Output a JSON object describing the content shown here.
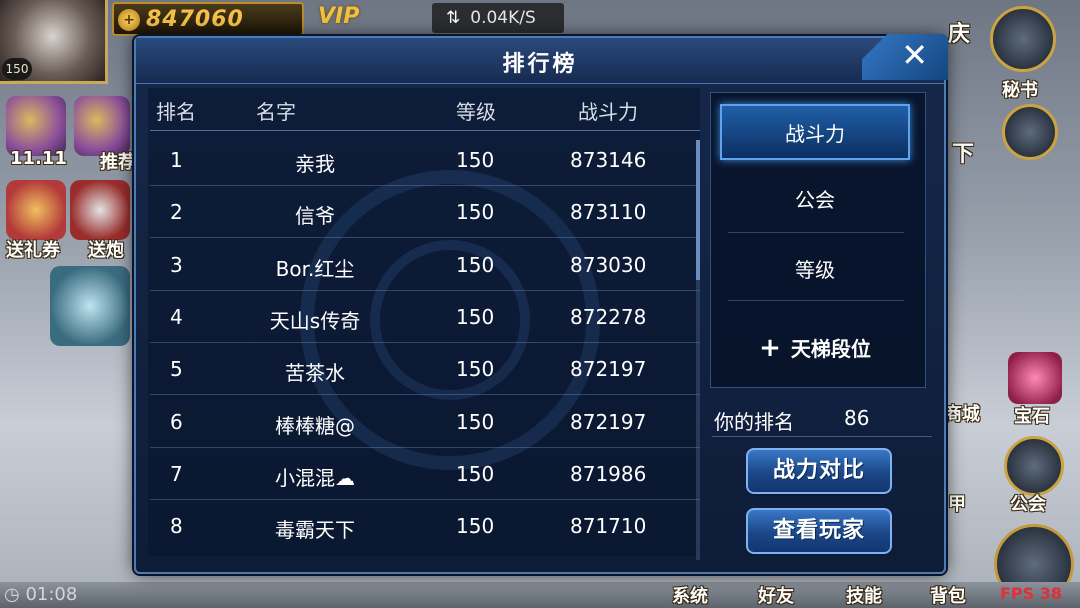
{
  "hud": {
    "player_level": "150",
    "gold": "847060",
    "vip_label": "VIP",
    "net_speed": "0.04K/S",
    "net_icon": "transfer-arrows-icon",
    "left_items": [
      {
        "label": "11.11",
        "icon": "gift-box-icon"
      },
      {
        "label": "推荐",
        "icon": "recommend-icon"
      },
      {
        "label": "送礼券",
        "icon": "voucher-icon"
      },
      {
        "label": "送炮",
        "icon": "cannon-icon"
      }
    ],
    "right_items": [
      {
        "label": "秘书",
        "icon": "secretary-icon"
      },
      {
        "label": "庆",
        "icon": "celebrate-icon"
      },
      {
        "label": "下",
        "icon": "download-icon"
      },
      {
        "label": "商城",
        "icon": "shop-icon"
      },
      {
        "label": "宝石",
        "icon": "gem-icon"
      },
      {
        "label": "甲",
        "icon": "armor-icon"
      },
      {
        "label": "公会",
        "icon": "guild-icon"
      }
    ],
    "bottom_items": [
      "系统",
      "好友",
      "技能",
      "背包"
    ],
    "timer": "01:08",
    "fps": "FPS 38"
  },
  "dialog": {
    "title": "排行榜",
    "close_icon": "close-icon",
    "columns": {
      "rank": "排名",
      "name": "名字",
      "level": "等级",
      "power": "战斗力"
    },
    "rows": [
      {
        "rank": "1",
        "name": "亲我",
        "level": "150",
        "power": "873146"
      },
      {
        "rank": "2",
        "name": "信爷",
        "level": "150",
        "power": "873110"
      },
      {
        "rank": "3",
        "name": "Bor.红尘",
        "level": "150",
        "power": "873030"
      },
      {
        "rank": "4",
        "name": "天山s传奇",
        "level": "150",
        "power": "872278"
      },
      {
        "rank": "5",
        "name": "苦茶水",
        "level": "150",
        "power": "872197"
      },
      {
        "rank": "6",
        "name": "棒棒糖@",
        "level": "150",
        "power": "872197"
      },
      {
        "rank": "7",
        "name": "小混混☁",
        "level": "150",
        "power": "871986"
      },
      {
        "rank": "8",
        "name": "毒霸天下",
        "level": "150",
        "power": "871710"
      }
    ],
    "tabs": {
      "power": "战斗力",
      "guild": "公会",
      "level": "等级",
      "ladder_plus": "+",
      "ladder": "天梯段位"
    },
    "my_rank_label": "你的排名",
    "my_rank_value": "86",
    "compare_button": "战力对比",
    "view_player_button": "查看玩家"
  }
}
